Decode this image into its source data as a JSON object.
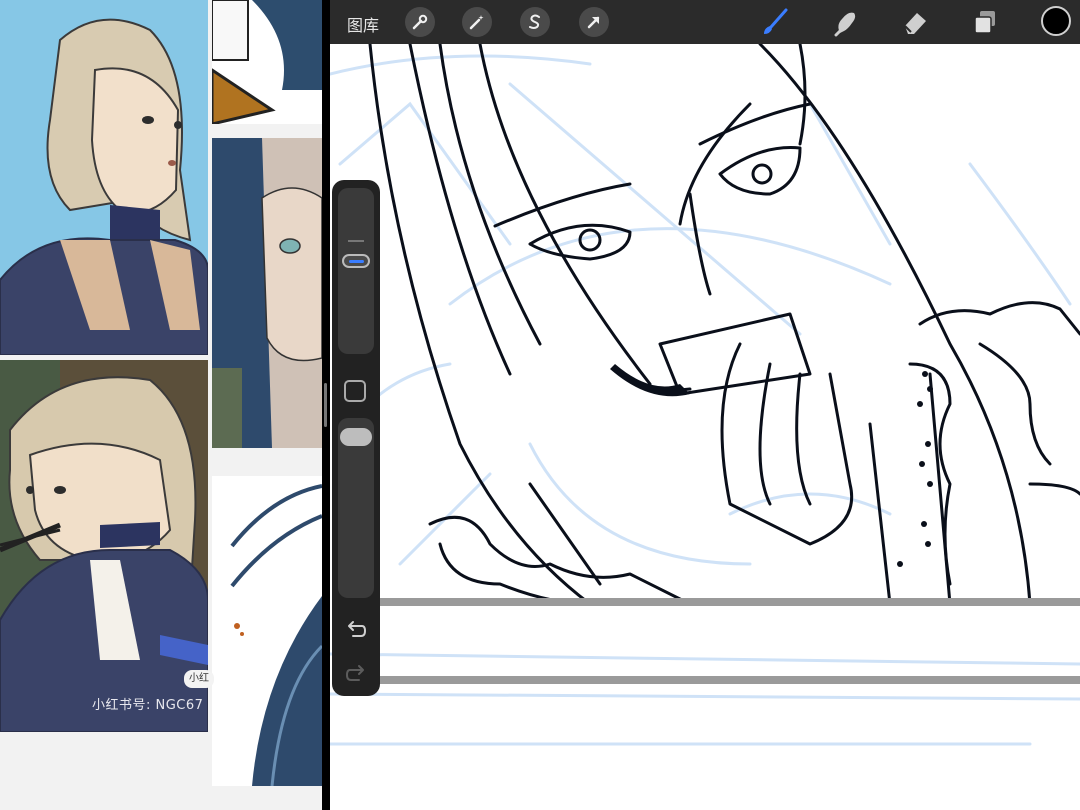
{
  "toolbar": {
    "gallery_label": "图库",
    "actions_icon": "wrench-icon",
    "adjustments_icon": "magic-wand-icon",
    "selection_icon": "selection-s-icon",
    "transform_icon": "arrow-cursor-icon",
    "brush_icon": "brush-icon",
    "smudge_icon": "smudge-icon",
    "eraser_icon": "eraser-icon",
    "layers_icon": "layers-icon",
    "current_color": "#000000",
    "active_tool_color": "#3a7dff"
  },
  "sidebar": {
    "undo_icon": "undo-icon",
    "redo_icon": "redo-icon"
  },
  "reference": {
    "watermark": "小红书号: NGC67",
    "badge": "小红"
  },
  "colors": {
    "toolbar_bg": "#2b2b2b",
    "sketch_blue": "#cfe2f7",
    "ink": "#0a0f1a",
    "ref_sky": "#86c7e6",
    "ref_navy": "#3a4368"
  }
}
